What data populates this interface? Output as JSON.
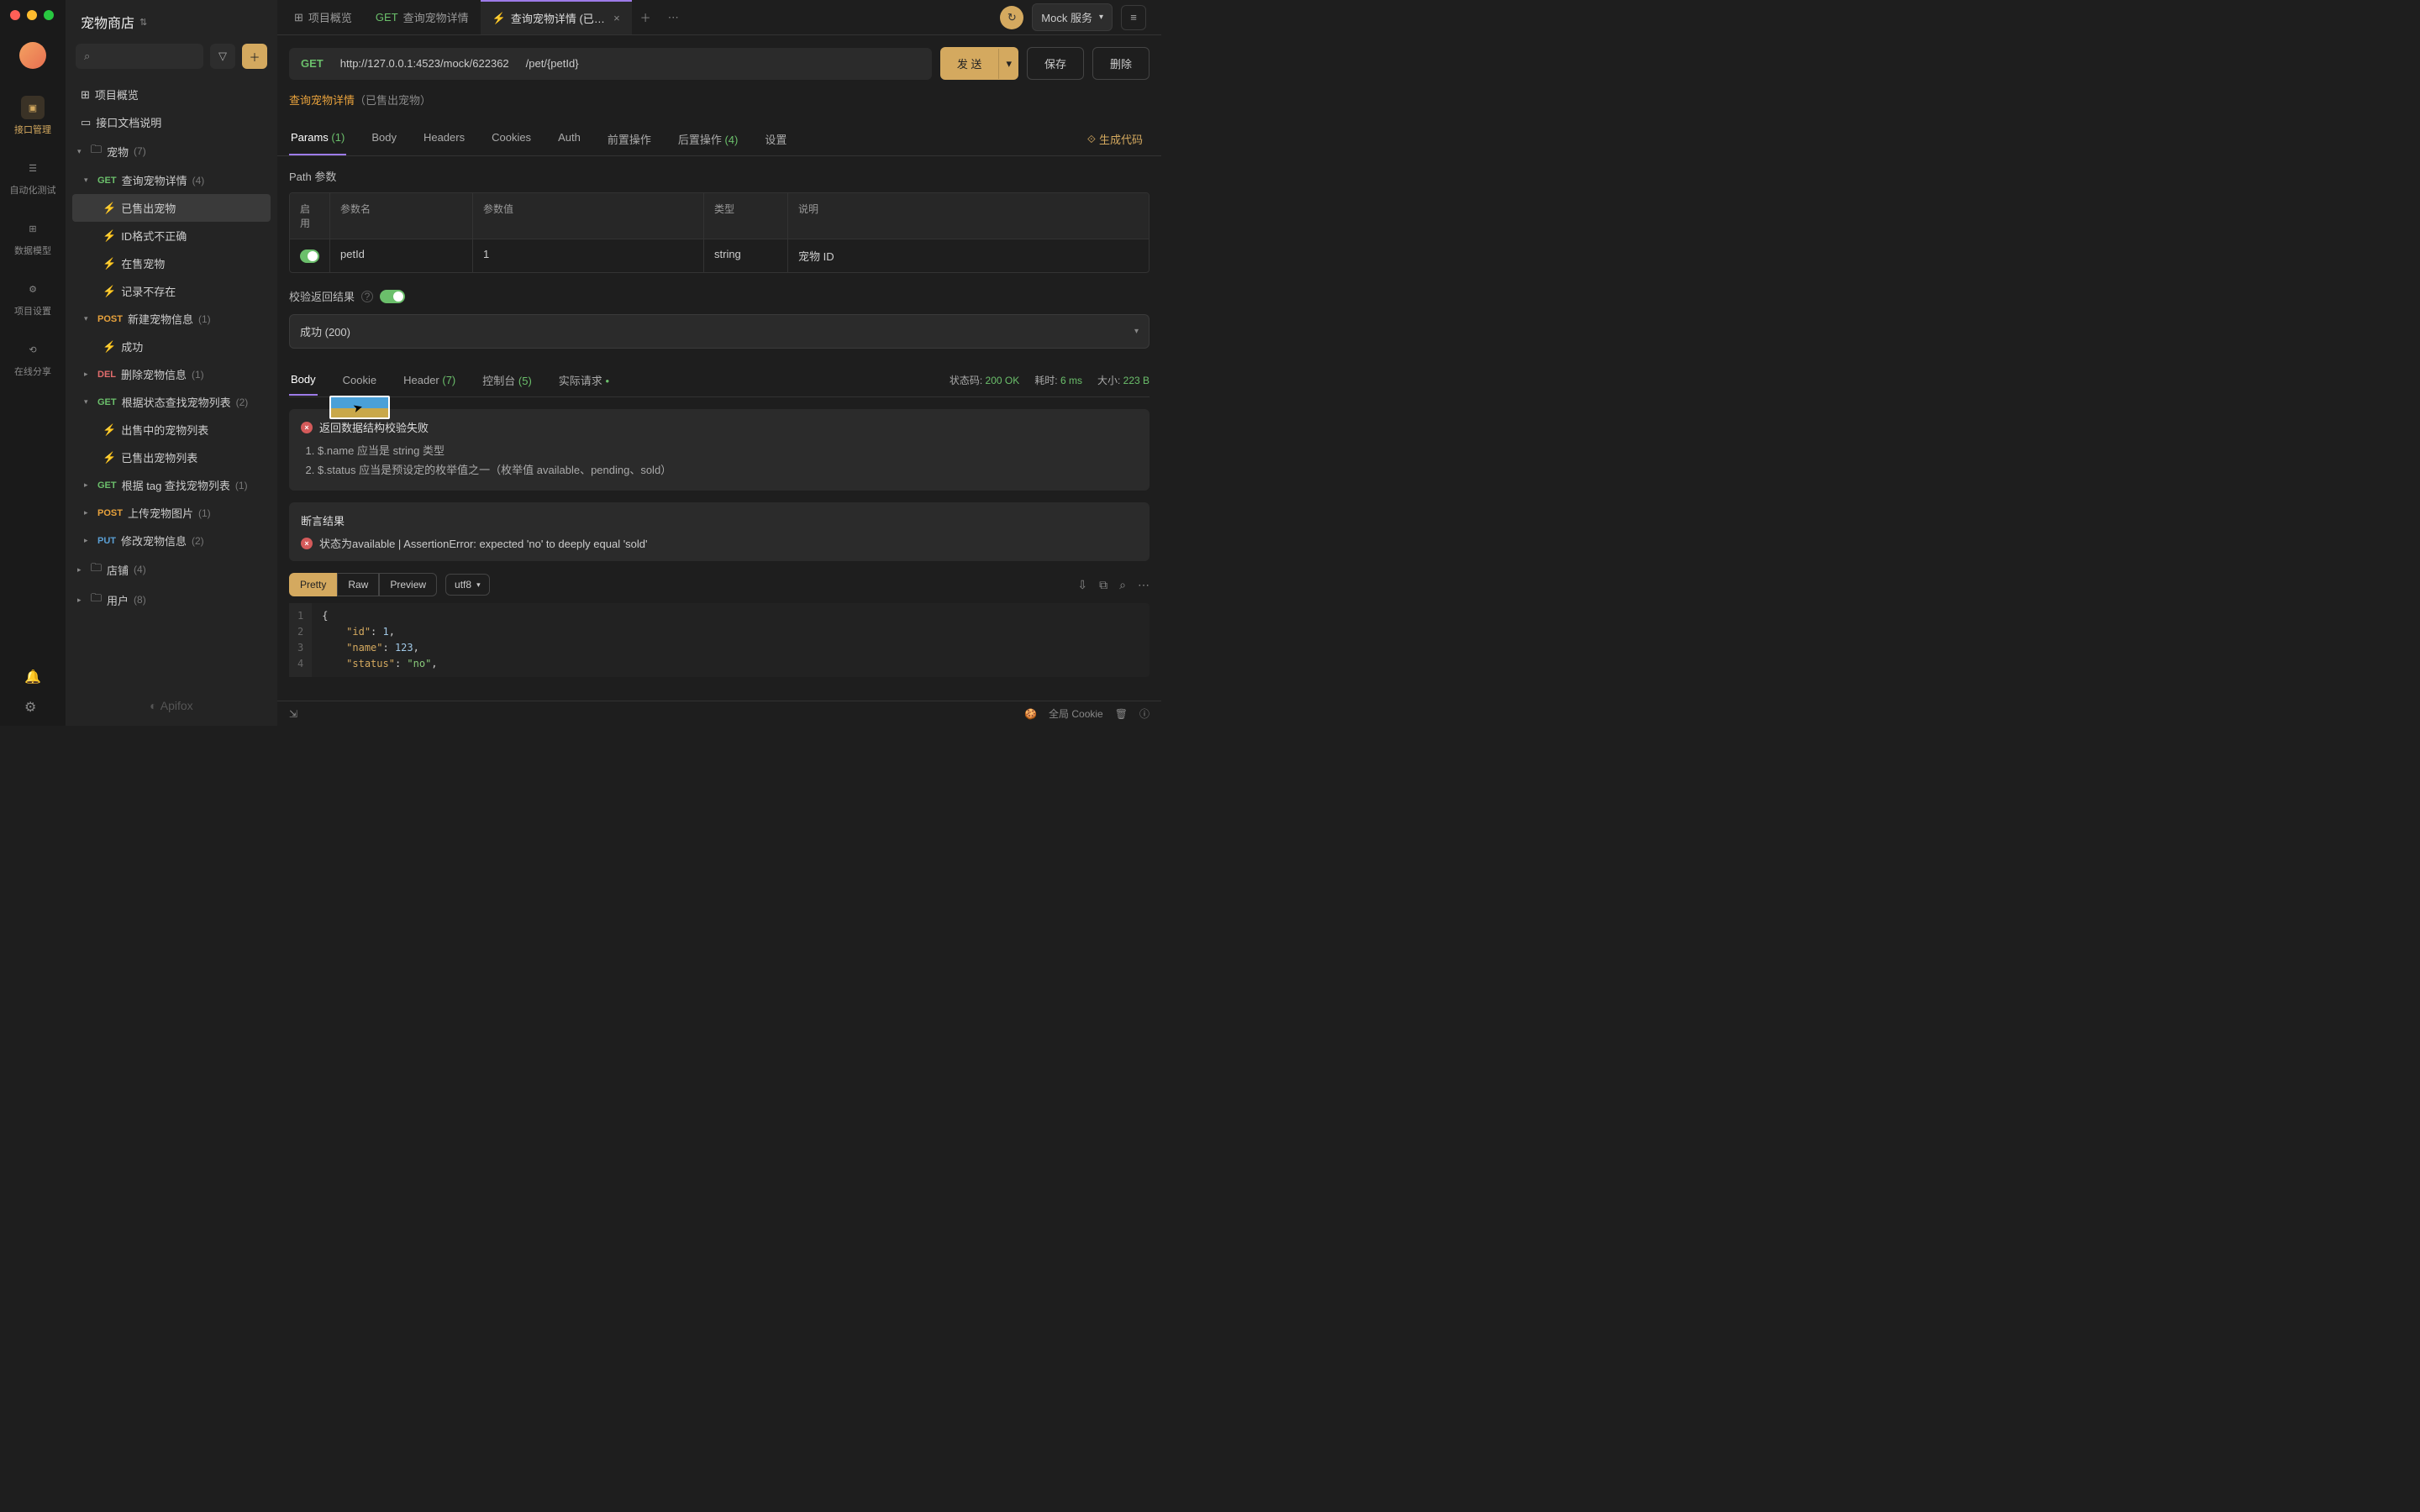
{
  "window": {
    "project_name": "宠物商店"
  },
  "rail": {
    "items": [
      {
        "label": "接口管理",
        "active": true
      },
      {
        "label": "自动化测试",
        "active": false
      },
      {
        "label": "数据模型",
        "active": false
      },
      {
        "label": "项目设置",
        "active": false
      },
      {
        "label": "在线分享",
        "active": false
      }
    ]
  },
  "tree": {
    "overview": "项目概览",
    "docs": "接口文档说明",
    "groups": {
      "pet": {
        "label": "宠物",
        "count": "(7)"
      },
      "shop": {
        "label": "店铺",
        "count": "(4)"
      },
      "user": {
        "label": "用户",
        "count": "(8)"
      }
    },
    "endpoints": {
      "get_detail": {
        "method": "GET",
        "label": "查询宠物详情",
        "count": "(4)"
      },
      "post_create": {
        "method": "POST",
        "label": "新建宠物信息",
        "count": "(1)"
      },
      "del_delete": {
        "method": "DEL",
        "label": "删除宠物信息",
        "count": "(1)"
      },
      "get_by_status": {
        "method": "GET",
        "label": "根据状态查找宠物列表",
        "count": "(2)"
      },
      "get_by_tag": {
        "method": "GET",
        "label": "根据 tag 查找宠物列表",
        "count": "(1)"
      },
      "post_upload": {
        "method": "POST",
        "label": "上传宠物图片",
        "count": "(1)"
      },
      "put_update": {
        "method": "PUT",
        "label": "修改宠物信息",
        "count": "(2)"
      }
    },
    "cases": {
      "sold": "已售出宠物",
      "bad_id": "ID格式不正确",
      "on_sale": "在售宠物",
      "not_found": "记录不存在",
      "success": "成功",
      "selling_list": "出售中的宠物列表",
      "sold_list": "已售出宠物列表"
    },
    "footer": "Apifox"
  },
  "tabs": {
    "t1": "项目概览",
    "t2": {
      "method": "GET",
      "label": "查询宠物详情"
    },
    "t3": {
      "icon": "bolt",
      "label": "查询宠物详情 (已售出"
    },
    "env_label": "Mock 服务"
  },
  "request": {
    "method": "GET",
    "base_url": "http://127.0.0.1:4523/mock/622362",
    "path": "/pet/{petId}",
    "send": "发 送",
    "save": "保存",
    "delete": "删除"
  },
  "breadcrumb": {
    "name": "查询宠物详情",
    "suffix": "（已售出宠物）"
  },
  "req_tabs": {
    "params": "Params",
    "params_count": "(1)",
    "body": "Body",
    "headers": "Headers",
    "cookies": "Cookies",
    "auth": "Auth",
    "pre": "前置操作",
    "post": "后置操作",
    "post_count": "(4)",
    "settings": "设置",
    "gen_code": "生成代码"
  },
  "params": {
    "section_title": "Path 参数",
    "headers": {
      "enable": "启用",
      "name": "参数名",
      "value": "参数值",
      "type": "类型",
      "desc": "说明"
    },
    "rows": [
      {
        "enabled": true,
        "name": "petId",
        "value": "1",
        "type": "string",
        "desc": "宠物 ID"
      }
    ]
  },
  "validate": {
    "label": "校验返回结果",
    "select_value": "成功 (200)"
  },
  "resp_tabs": {
    "body": "Body",
    "cookie": "Cookie",
    "header": "Header",
    "header_count": "(7)",
    "console": "控制台",
    "console_count": "(5)",
    "actual": "实际请求",
    "dot": "•"
  },
  "resp_status": {
    "code_label": "状态码:",
    "code": "200 OK",
    "time_label": "耗时:",
    "time": "6 ms",
    "size_label": "大小:",
    "size": "223 B"
  },
  "validation_error": {
    "title": "返回数据结构校验失败",
    "items": [
      "$.name 应当是 string 类型",
      "$.status 应当是预设定的枚举值之一（枚举值 available、pending、sold）"
    ]
  },
  "assertion": {
    "title": "断言结果",
    "line": "状态为available | AssertionError: expected 'no' to deeply equal 'sold'"
  },
  "body_viewer": {
    "pretty": "Pretty",
    "raw": "Raw",
    "preview": "Preview",
    "encoding": "utf8",
    "json": {
      "l1": "{",
      "l2_k": "\"id\"",
      "l2_v": "1",
      "l3_k": "\"name\"",
      "l3_v": "123",
      "l4_k": "\"status\"",
      "l4_v": "\"no\""
    }
  },
  "statusbar": {
    "cookie": "全局 Cookie"
  }
}
